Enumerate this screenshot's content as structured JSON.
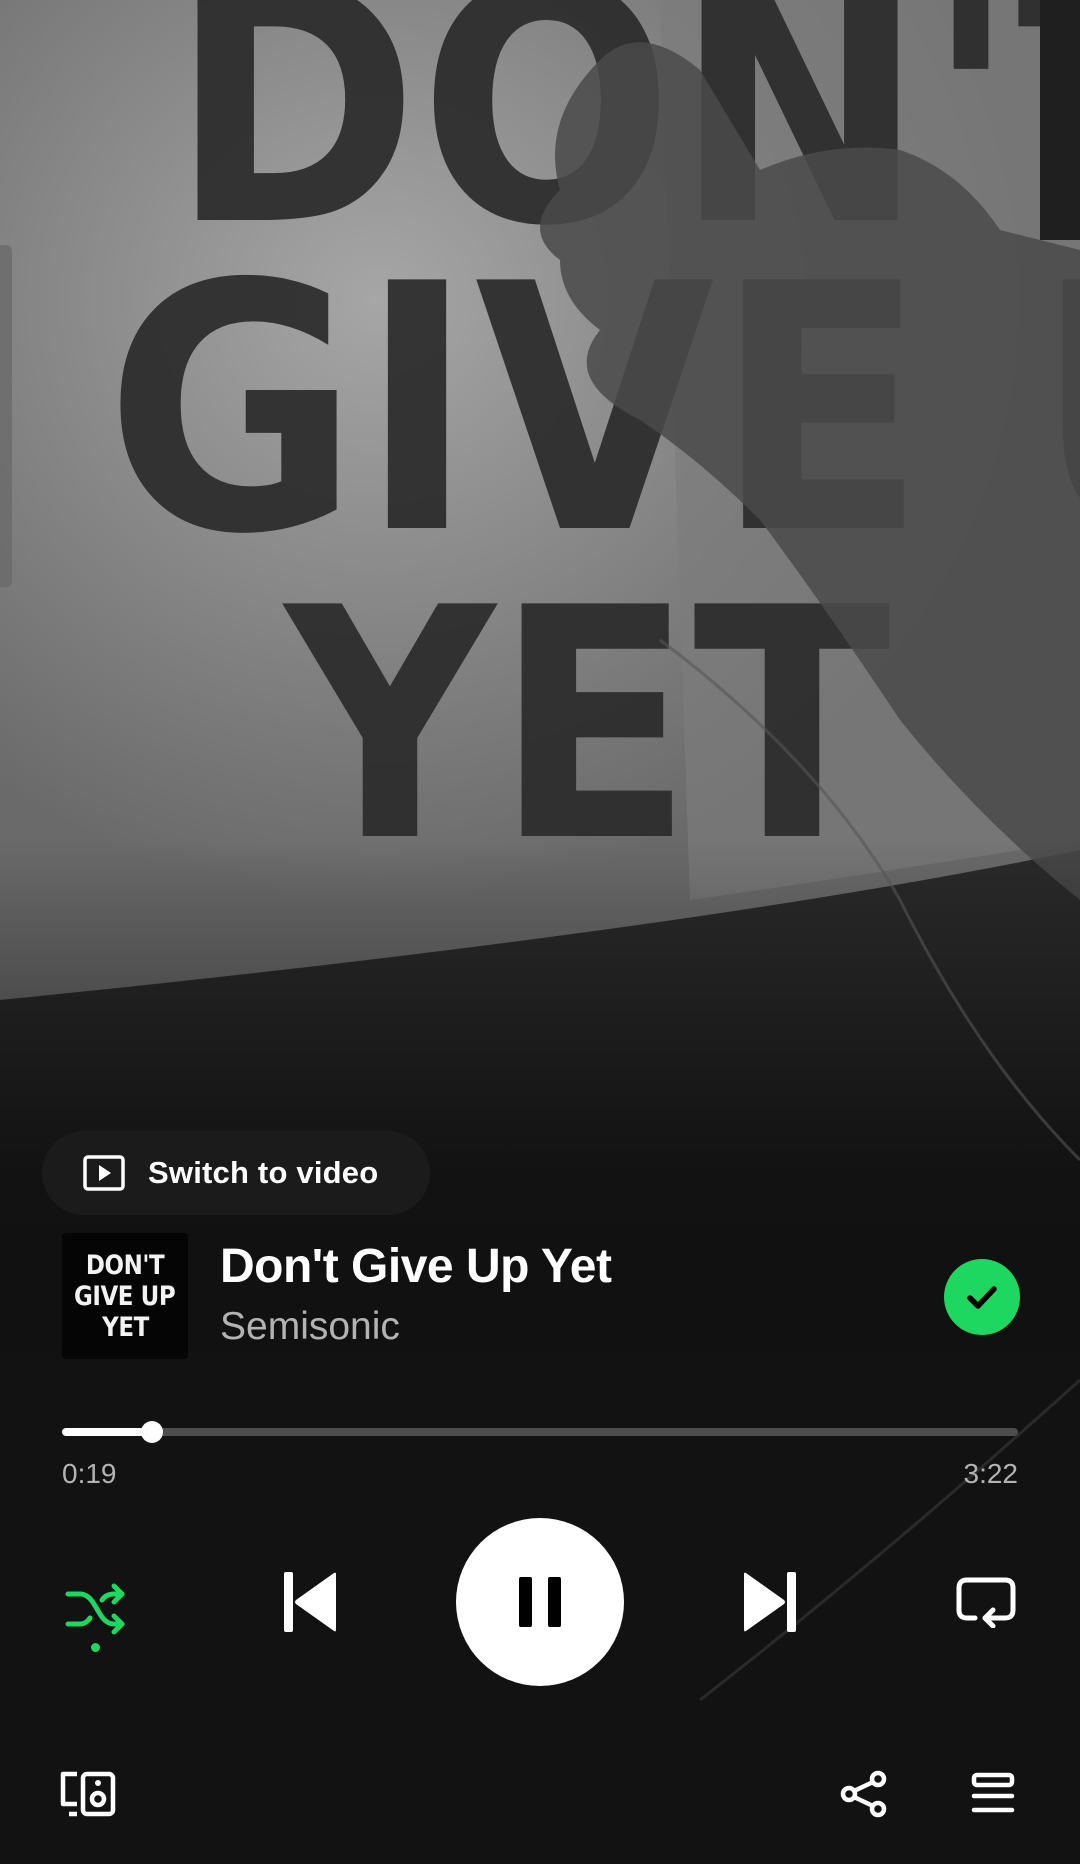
{
  "background": {
    "sign_text_lines": [
      "DON'T",
      "GIVE UP",
      "YET"
    ]
  },
  "switch_video": {
    "label": "Switch to video",
    "icon": "play-square-icon"
  },
  "track": {
    "title": "Don't Give Up Yet",
    "artist": "Semisonic",
    "cover_text_lines": [
      "DON'T",
      "GIVE UP",
      "YET"
    ],
    "saved": true
  },
  "playback": {
    "elapsed": "0:19",
    "duration": "3:22",
    "progress_fraction": 0.094,
    "state": "playing",
    "shuffle_enabled": true
  },
  "controls": {
    "shuffle_icon": "shuffle-icon",
    "previous_icon": "skip-previous-icon",
    "play_pause_icon": "pause-icon",
    "next_icon": "skip-next-icon",
    "repeat_icon": "repeat-icon",
    "device_icon": "connect-device-icon",
    "share_icon": "share-icon",
    "queue_icon": "queue-icon"
  },
  "colors": {
    "accent": "#1ed760",
    "background": "#121212",
    "text_primary": "#ffffff",
    "text_secondary": "#b3b3b3",
    "track_inactive": "#4d4d4d"
  }
}
